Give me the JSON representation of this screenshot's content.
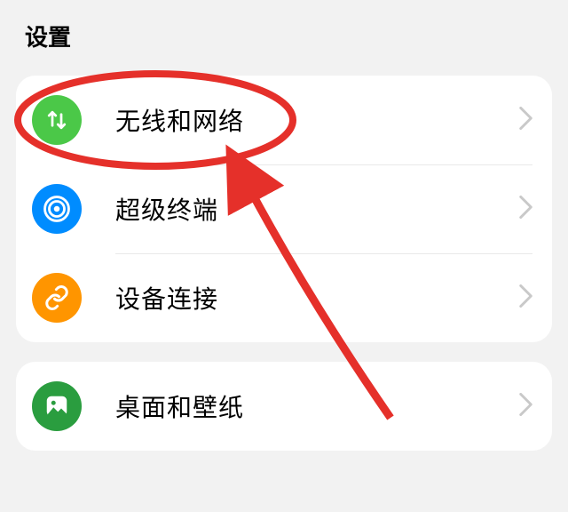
{
  "page_title": "设置",
  "groups": [
    {
      "items": [
        {
          "id": "wireless",
          "label": "无线和网络"
        },
        {
          "id": "superdev",
          "label": "超级终端"
        },
        {
          "id": "devconn",
          "label": "设备连接"
        }
      ]
    },
    {
      "items": [
        {
          "id": "wallpaper",
          "label": "桌面和壁纸"
        }
      ]
    }
  ]
}
